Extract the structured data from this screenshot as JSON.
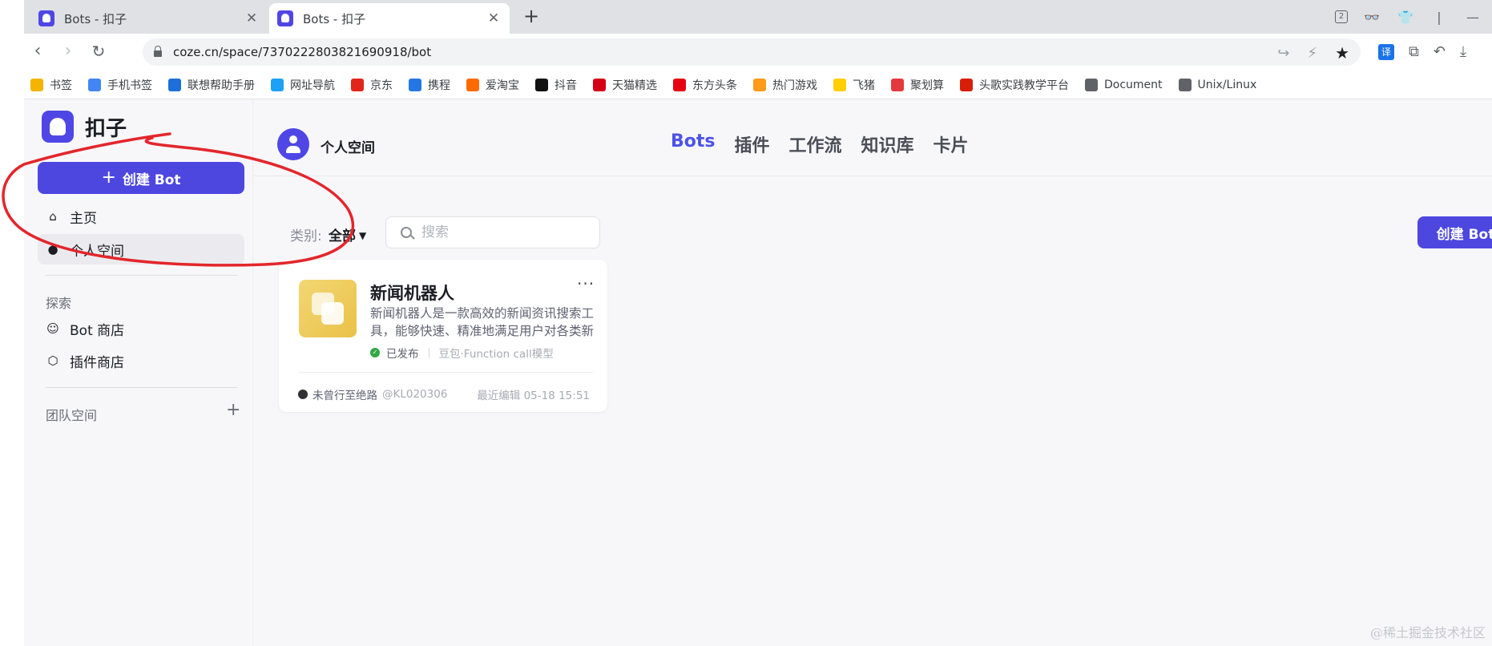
{
  "browser": {
    "tabs": [
      {
        "title": "Bots - 扣子",
        "active": false
      },
      {
        "title": "Bots - 扣子",
        "active": true
      }
    ],
    "new_tab": "+",
    "tab_count_badge": "2",
    "url": "coze.cn/space/7370222803821690918/bot",
    "bookmarks": [
      {
        "label": "书签",
        "color": "#f4b400"
      },
      {
        "label": "手机书签",
        "color": "#4285f4"
      },
      {
        "label": "联想帮助手册",
        "color": "#1e6fd9"
      },
      {
        "label": "网址导航",
        "color": "#1da1f2"
      },
      {
        "label": "京东",
        "color": "#e1251b"
      },
      {
        "label": "携程",
        "color": "#2577e3"
      },
      {
        "label": "爱淘宝",
        "color": "#ff6a00"
      },
      {
        "label": "抖音",
        "color": "#111111"
      },
      {
        "label": "天猫精选",
        "color": "#d40016"
      },
      {
        "label": "东方头条",
        "color": "#e60012"
      },
      {
        "label": "热门游戏",
        "color": "#ff9a1a"
      },
      {
        "label": "飞猪",
        "color": "#ffcf00"
      },
      {
        "label": "聚划算",
        "color": "#e4393c"
      },
      {
        "label": "头歌实践教学平台",
        "color": "#d81e06"
      },
      {
        "label": "Document",
        "color": "#5f6368"
      },
      {
        "label": "Unix/Linux",
        "color": "#5f6368"
      }
    ]
  },
  "sidebar": {
    "logo_text": "扣子",
    "create_button": "创建 Bot",
    "nav": [
      {
        "label": "主页",
        "icon": "home-icon"
      },
      {
        "label": "个人空间",
        "icon": "user-icon"
      }
    ],
    "explore_title": "探索",
    "explore": [
      {
        "label": "Bot 商店",
        "icon": "bot-store-icon"
      },
      {
        "label": "插件商店",
        "icon": "cube-icon"
      }
    ],
    "team_space": "团队空间"
  },
  "main": {
    "space_name": "个人空间",
    "tabs": [
      "Bots",
      "插件",
      "工作流",
      "知识库",
      "卡片"
    ],
    "active_tab": "Bots",
    "category_label": "类别:",
    "category_value": "全部",
    "search_placeholder": "搜索",
    "create_button": "创建 Bot",
    "bots": [
      {
        "name": "新闻机器人",
        "description": "新闻机器人是一款高效的新闻资讯搜索工具，能够快速、精准地满足用户对各类新闻资讯的搜索需求。",
        "status": "已发布",
        "model": "豆包·Function call模型",
        "owner": "未曾行至绝路",
        "handle": "@KL020306",
        "edited": "最近编辑 05-18 15:51"
      }
    ]
  },
  "watermark": "@稀土掘金技术社区",
  "colors": {
    "accent": "#4d53e8",
    "button": "#4d47e0",
    "annotation": "#e3262b"
  }
}
